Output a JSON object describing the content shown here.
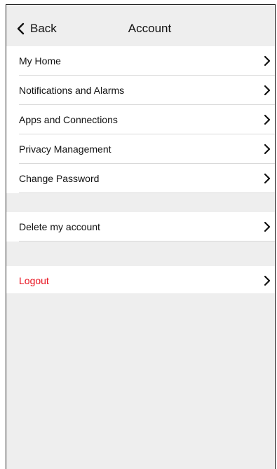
{
  "header": {
    "back_label": "Back",
    "back_icon": "chevron-left-icon",
    "title": "Account"
  },
  "menu_main": [
    {
      "label": "My Home",
      "icon": "chevron-right-icon"
    },
    {
      "label": "Notifications and Alarms",
      "icon": "chevron-right-icon"
    },
    {
      "label": "Apps and Connections",
      "icon": "chevron-right-icon"
    },
    {
      "label": "Privacy Management",
      "icon": "chevron-right-icon"
    },
    {
      "label": "Change Password",
      "icon": "chevron-right-icon"
    }
  ],
  "menu_delete": {
    "label": "Delete my account",
    "icon": "chevron-right-icon"
  },
  "menu_logout": {
    "label": "Logout",
    "icon": "chevron-right-icon",
    "color": "#e8101d"
  },
  "colors": {
    "background": "#eeeeee",
    "row_background": "#ffffff",
    "divider": "#d9d9d9",
    "danger": "#e8101d"
  }
}
